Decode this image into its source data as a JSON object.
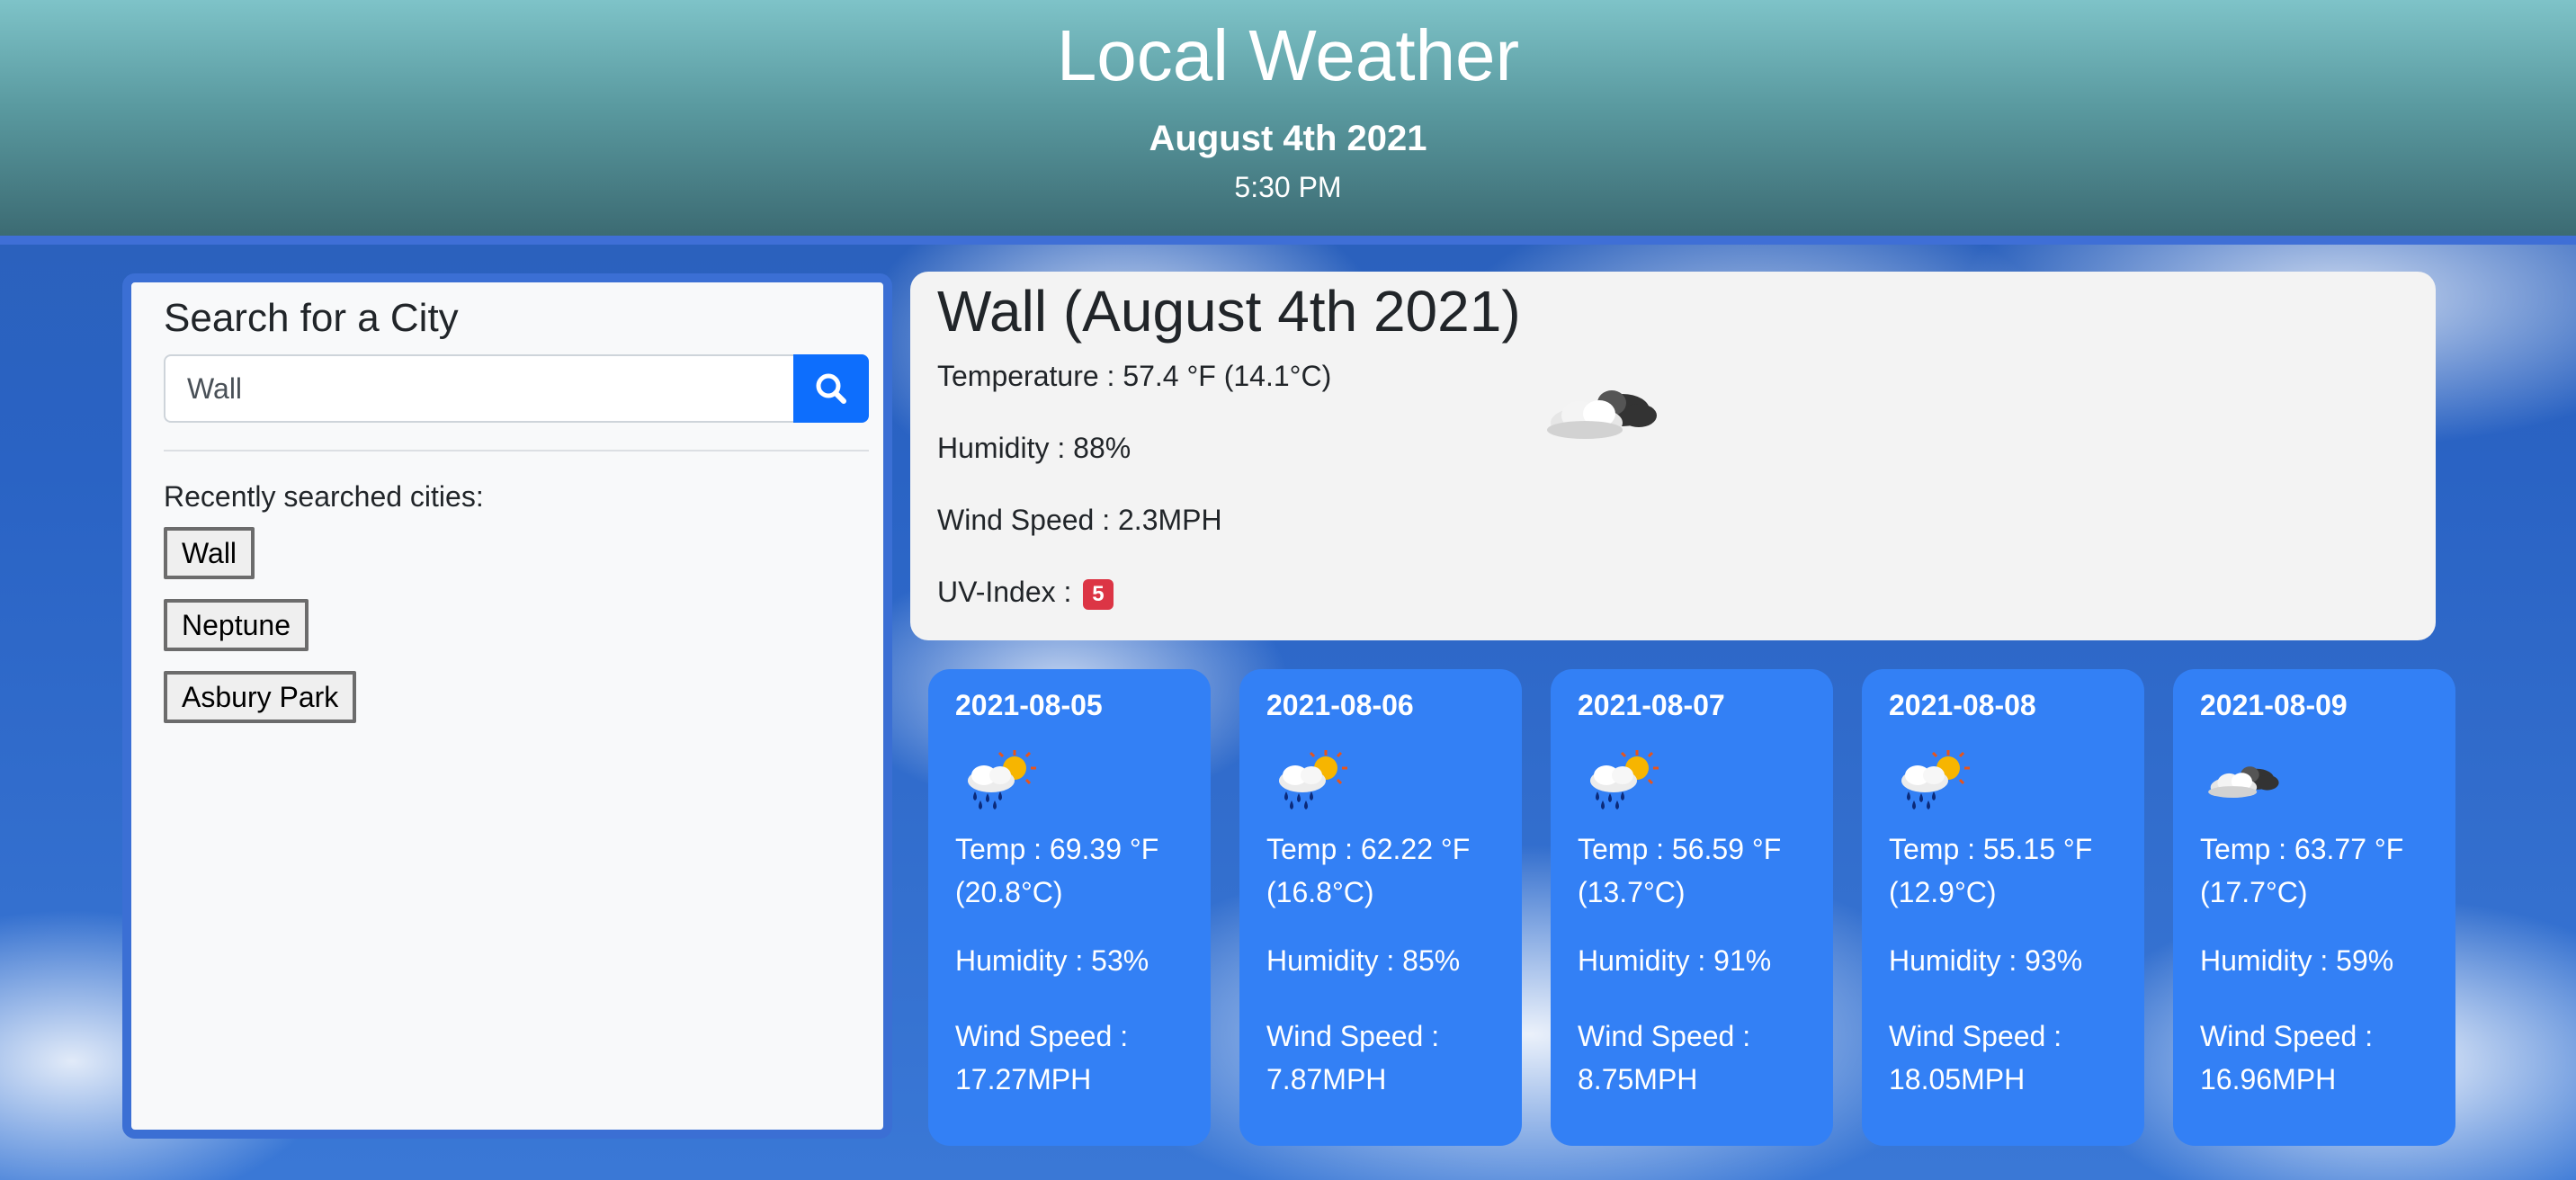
{
  "header": {
    "title": "Local Weather",
    "date": "August 4th 2021",
    "time": "5:30 PM"
  },
  "search": {
    "heading": "Search for a City",
    "input_value": "Wall",
    "button_icon": "search-icon",
    "recent_label": "Recently searched cities:",
    "recent_cities": [
      "Wall",
      "Neptune",
      "Asbury Park"
    ]
  },
  "current": {
    "city": "Wall (August 4th 2021)",
    "temperature": "Temperature : 57.4 °F (14.1°C)",
    "humidity": "Humidity : 88%",
    "wind": "Wind Speed : 2.3MPH",
    "uv_label": "UV-Index :",
    "uv_value": "5",
    "uv_color": "#dc3545",
    "icon": "cloudy-icon"
  },
  "forecast": [
    {
      "date": "2021-08-05",
      "icon": "rain-sun-icon",
      "temp": "Temp : 69.39 °F (20.8°C)",
      "humidity": "Humidity : 53%",
      "wind": "Wind Speed : 17.27MPH"
    },
    {
      "date": "2021-08-06",
      "icon": "rain-sun-icon",
      "temp": "Temp : 62.22 °F (16.8°C)",
      "humidity": "Humidity : 85%",
      "wind": "Wind Speed : 7.87MPH"
    },
    {
      "date": "2021-08-07",
      "icon": "rain-sun-icon",
      "temp": "Temp : 56.59 °F (13.7°C)",
      "humidity": "Humidity : 91%",
      "wind": "Wind Speed : 8.75MPH"
    },
    {
      "date": "2021-08-08",
      "icon": "rain-sun-icon",
      "temp": "Temp : 55.15 °F (12.9°C)",
      "humidity": "Humidity : 93%",
      "wind": "Wind Speed : 18.05MPH"
    },
    {
      "date": "2021-08-09",
      "icon": "cloudy-icon",
      "temp": "Temp : 63.77 °F (17.7°C)",
      "humidity": "Humidity : 59%",
      "wind": "Wind Speed : 16.96MPH"
    }
  ],
  "colors": {
    "accent": "#0d6efd",
    "card_blue": "#3380f5",
    "header_border": "#3f6fd6"
  }
}
